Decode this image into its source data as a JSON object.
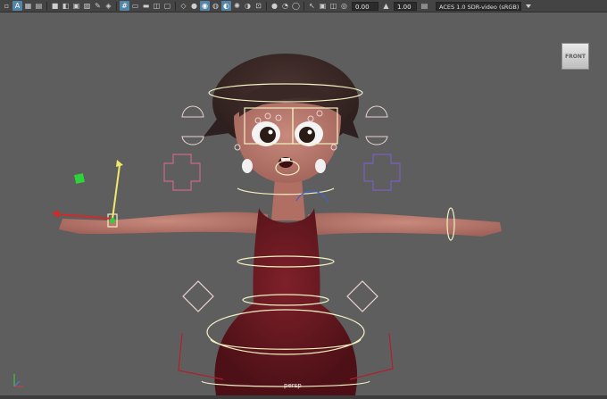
{
  "toolbar": {
    "left_icons": [
      "select-icon",
      "lasso-icon",
      "paint-icon",
      "camera-icon",
      "camera-lock-icon",
      "bookmark-icon",
      "image-plane-icon",
      "grid-2d-icon",
      "grid-icon",
      "snapshot-icon",
      "film-gate-icon",
      "resolution-gate-icon",
      "gate-mask-icon",
      "field-chart-icon",
      "safe-action-icon",
      "safe-title-icon",
      "wireframe-icon",
      "smooth-shade-icon",
      "textured-icon",
      "lighting-icon",
      "shadow-icon",
      "ambient-occlusion-icon",
      "motion-blur-icon",
      "anti-alias-icon",
      "depth-of-field-icon",
      "isolate-icon",
      "xray-icon",
      "xray-joints-icon",
      "backface-icon"
    ],
    "exposure_value": "0.00",
    "gamma_value": "1.00",
    "color_space": "ACES 1.0 SDR-video (sRGB)"
  },
  "viewport": {
    "view_cube_label": "FRONT",
    "camera_label": "persp"
  },
  "colors": {
    "viewport_bg": "#5e5e5e",
    "toolbar_bg": "#444444",
    "active_button": "#5285a6",
    "rig_control": "#f3f0c2",
    "dress": "#6e1a22",
    "skin": "#b9776c"
  }
}
